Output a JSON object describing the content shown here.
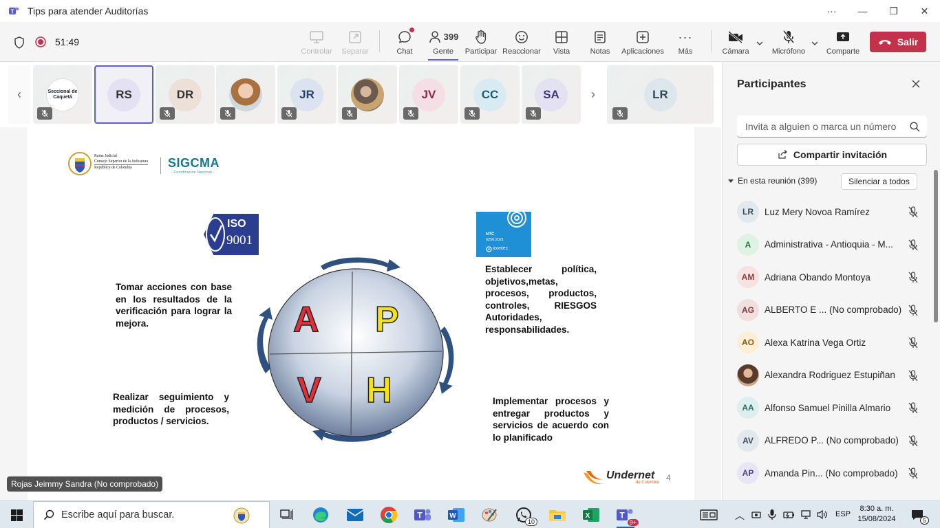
{
  "window": {
    "title": "Tips para atender Auditorías"
  },
  "meeting": {
    "timer": "51:49"
  },
  "toolbar": {
    "controlar": "Controlar",
    "separar": "Separar",
    "chat": "Chat",
    "gente": "Gente",
    "gente_count": "399",
    "participar": "Participar",
    "reaccionar": "Reaccionar",
    "vista": "Vista",
    "notas": "Notas",
    "aplicaciones": "Aplicaciones",
    "mas": "Más",
    "camara": "Cámara",
    "microfono": "Micrófono",
    "comparte": "Comparte",
    "salir": "Salir"
  },
  "strip": {
    "tiles": [
      {
        "initials": "",
        "logo": "Seccional de Caquetá",
        "kind": "logo"
      },
      {
        "initials": "RS",
        "kind": "initials",
        "selected": true
      },
      {
        "initials": "DR",
        "kind": "initials"
      },
      {
        "initials": "",
        "kind": "photo"
      },
      {
        "initials": "JR",
        "kind": "initials"
      },
      {
        "initials": "",
        "kind": "photo"
      },
      {
        "initials": "JV",
        "kind": "initials"
      },
      {
        "initials": "CC",
        "kind": "initials"
      },
      {
        "initials": "SA",
        "kind": "initials"
      }
    ],
    "last_tile": "LR"
  },
  "slide": {
    "org_line1": "Rama Judicial",
    "org_line2": "Consejo Superior de la Judicatura",
    "org_line3": "República de Colombia",
    "sigcma": "SIGCMA",
    "sigcma_sub": "- Coordinación Nacional -",
    "iso_top": "ISO",
    "iso_num": "9001",
    "ntc_line1": "NTC",
    "ntc_line2": "6256:2021",
    "ntc_brand": "icontec",
    "letters": {
      "a": "A",
      "p": "P",
      "v": "V",
      "h": "H"
    },
    "text_a": "Tomar acciones con base en los resultados de la verificación para lograr la mejora.",
    "text_p": "Establecer política, objetivos,metas, procesos, productos, controles, RIESGOS Autoridades, responsabilidades.",
    "text_v": "Realizar seguimiento y medición de procesos, productos / servicios.",
    "text_h": "Implementar procesos y entregar productos y servicios de acuerdo con lo planificado",
    "footer_brand": "Undernet",
    "footer_sub": "de Colombia",
    "page_number": "4"
  },
  "presenter": {
    "name": "Rojas Jeimmy Sandra (No comprobado)"
  },
  "panel": {
    "title": "Participantes",
    "invite_placeholder": "Invita a alguien o marca un número",
    "share_invite": "Compartir invitación",
    "section": "En esta reunión (399)",
    "mute_all": "Silenciar a todos",
    "participants": [
      {
        "initials": "LR",
        "name": "Luz Mery Novoa Ramírez",
        "color": "#e1e8ee",
        "fg": "#3b4a56"
      },
      {
        "initials": "A",
        "name": "Administrativa - Antioquia - M...",
        "color": "#dff3e4",
        "fg": "#2e6b3c"
      },
      {
        "initials": "AM",
        "name": "Adriana Obando Montoya",
        "color": "#f7e1e1",
        "fg": "#8a3b3b"
      },
      {
        "initials": "AG",
        "name": "ALBERTO E ...  (No comprobado)",
        "color": "#f1dede",
        "fg": "#7a3a3a"
      },
      {
        "initials": "AO",
        "name": "Alexa Katrina Vega Ortiz",
        "color": "#fcefd8",
        "fg": "#8a5a13"
      },
      {
        "initials": "",
        "name": "Alexandra Rodriguez Estupiñan",
        "color": "#7a5a48",
        "fg": "#fff"
      },
      {
        "initials": "AA",
        "name": "Alfonso Samuel Pinilla Almario",
        "color": "#dcefee",
        "fg": "#2d6a66"
      },
      {
        "initials": "AV",
        "name": "ALFREDO P...  (No comprobado)",
        "color": "#e2e8ec",
        "fg": "#38505e"
      },
      {
        "initials": "AP",
        "name": "Amanda Pin...  (No comprobado)",
        "color": "#e8e6f5",
        "fg": "#4b4585"
      }
    ]
  },
  "taskbar": {
    "search_placeholder": "Escribe aquí para buscar.",
    "whatsapp_badge": "10",
    "teams_badge": "9+",
    "language": "ESP",
    "time": "8:30 a. m.",
    "date": "15/08/2024",
    "notif_count": "5"
  }
}
